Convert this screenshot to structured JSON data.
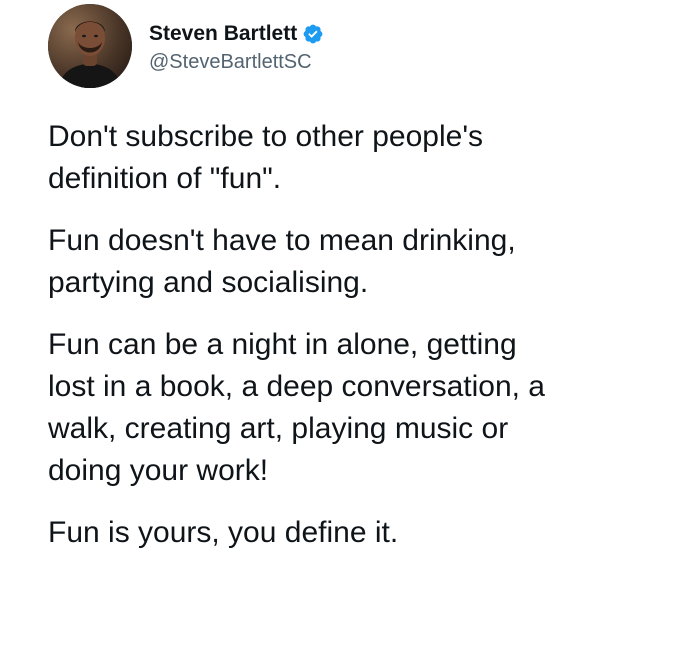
{
  "author": {
    "display_name": "Steven Bartlett",
    "handle": "@SteveBartlettSC",
    "verified": true,
    "verified_color": "#1d9bf0"
  },
  "tweet": {
    "paragraphs": [
      "Don't subscribe to other people's\ndefinition of \"fun\".",
      "Fun doesn't have to mean drinking,\npartying and socialising.",
      "Fun can be a night in alone, getting\nlost in a book, a deep conversation, a\nwalk, creating art, playing music or\ndoing your work!",
      "Fun is yours, you define it."
    ]
  },
  "colors": {
    "text": "#0f1419",
    "secondary_text": "#536471",
    "background": "#ffffff"
  }
}
